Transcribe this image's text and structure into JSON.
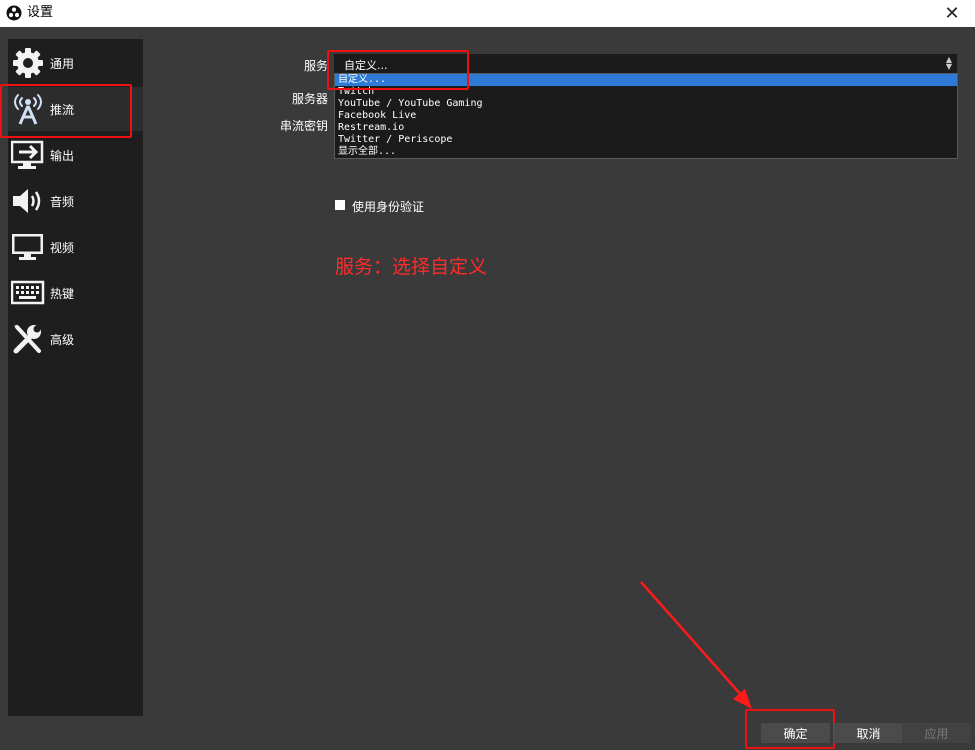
{
  "window": {
    "title": "设置",
    "close_glyph": "✕",
    "app_icon": "obs-logo-icon"
  },
  "sidebar": {
    "items": [
      {
        "label": "通用",
        "icon": "gear-icon"
      },
      {
        "label": "推流",
        "icon": "broadcast-antenna-icon",
        "active": true
      },
      {
        "label": "输出",
        "icon": "output-monitor-icon"
      },
      {
        "label": "音频",
        "icon": "speaker-icon"
      },
      {
        "label": "视频",
        "icon": "monitor-icon"
      },
      {
        "label": "热键",
        "icon": "keyboard-icon"
      },
      {
        "label": "高级",
        "icon": "tools-icon"
      }
    ]
  },
  "stream": {
    "service_label": "服务",
    "server_label": "服务器",
    "key_label": "串流密钥",
    "service_value": "自定义...",
    "service_options": [
      "自定义...",
      "Twitch",
      "YouTube / YouTube Gaming",
      "Facebook Live",
      "Restream.io",
      "Twitter / Periscope",
      "显示全部..."
    ],
    "selected_option_index": 0,
    "auth_checkbox_label": "使用身份验证",
    "auth_checked": false
  },
  "annotation": {
    "text": "服务：选择自定义",
    "color": "#ff2a2a"
  },
  "buttons": {
    "ok": "确定",
    "cancel": "取消",
    "apply": "应用"
  },
  "colors": {
    "selection": "#2d7bd6",
    "background": "#3a3a3a",
    "sidebar": "#1e1e1e"
  }
}
